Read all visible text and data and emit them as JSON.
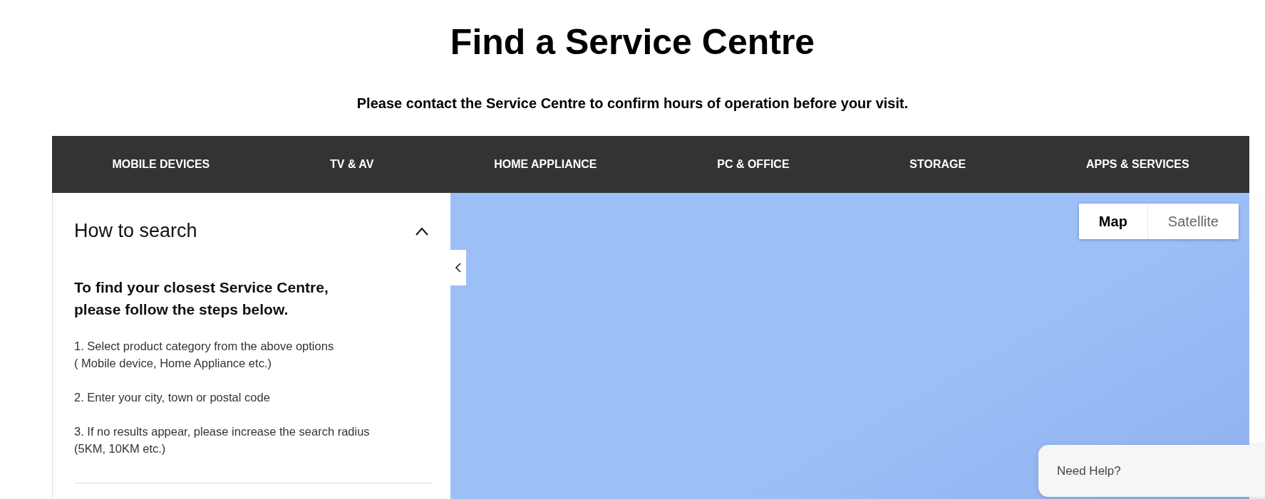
{
  "page": {
    "title": "Find a Service Centre",
    "subtitle": "Please contact the Service Centre to confirm hours of operation before your visit."
  },
  "categories": [
    {
      "label": "MOBILE DEVICES"
    },
    {
      "label": "TV & AV"
    },
    {
      "label": "HOME APPLIANCE"
    },
    {
      "label": "PC & OFFICE"
    },
    {
      "label": "STORAGE"
    },
    {
      "label": "APPS & SERVICES"
    }
  ],
  "panel": {
    "title": "How to search",
    "expanded": true,
    "intro": [
      "To find your closest Service Centre,",
      "please follow the steps below."
    ],
    "steps": [
      [
        "1. Select product category from the above options",
        "( Mobile device, Home Appliance etc.)"
      ],
      [
        "2. Enter your city, town or postal code"
      ],
      [
        "3. If no results appear, please increase the search radius",
        "(5KM, 10KM etc.)"
      ]
    ]
  },
  "map": {
    "types": [
      {
        "label": "Map",
        "selected": true
      },
      {
        "label": "Satellite",
        "selected": false
      }
    ]
  },
  "help": {
    "label": "Need Help?"
  }
}
